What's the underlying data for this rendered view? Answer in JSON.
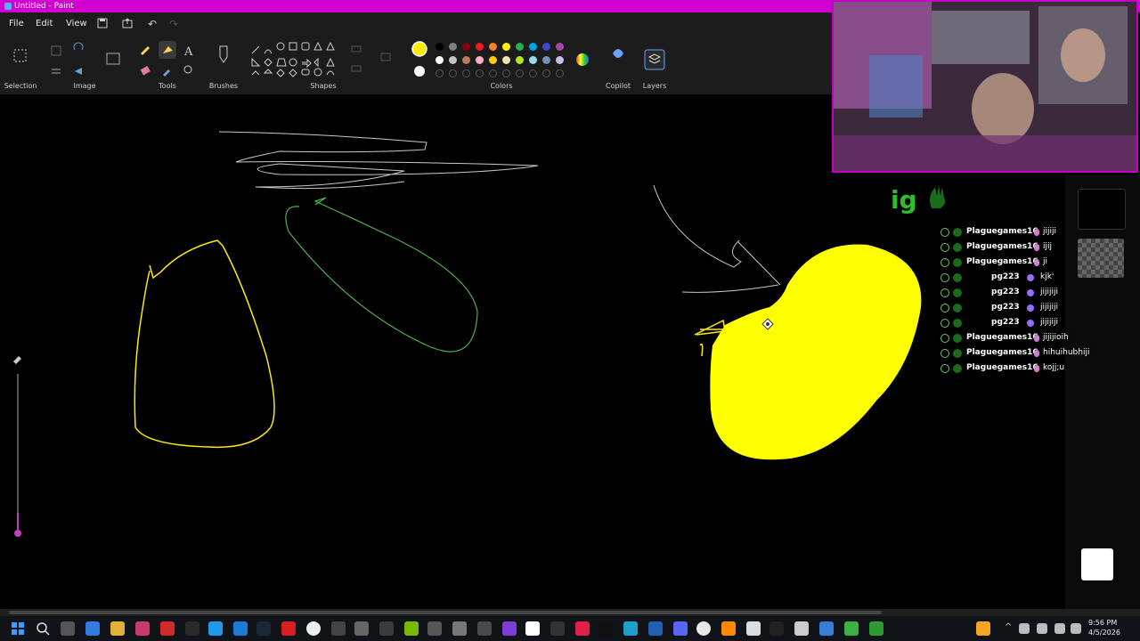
{
  "window": {
    "title": "Untitled - Paint"
  },
  "menu": {
    "file": "File",
    "edit": "Edit",
    "view": "View"
  },
  "ribbon": {
    "groups": {
      "selection": "Selection",
      "image": "Image",
      "tools": "Tools",
      "brushes": "Brushes",
      "shapes": "Shapes",
      "colors": "Colors",
      "copilot": "Copilot",
      "layers": "Layers"
    },
    "active_color": "#ffeb00",
    "palette_row1": [
      "#000000",
      "#7f7f7f",
      "#880015",
      "#ed1c24",
      "#ff7f27",
      "#fff200",
      "#22b14c",
      "#00a2e8",
      "#3f48cc",
      "#a349a4"
    ],
    "palette_row2": [
      "#ffffff",
      "#c3c3c3",
      "#b97a57",
      "#ffaec9",
      "#ffc90e",
      "#efe4b0",
      "#b5e61d",
      "#99d9ea",
      "#7092be",
      "#c8bfe7"
    ]
  },
  "overlay": {
    "ticker": "ig"
  },
  "chat": [
    {
      "user": "Plaguegames16",
      "msg": "jijiji",
      "badge": false
    },
    {
      "user": "Plaguegames16",
      "msg": "ijij",
      "badge": false
    },
    {
      "user": "Plaguegames16",
      "msg": "ji",
      "badge": false
    },
    {
      "user": "pg223",
      "msg": "kjk'",
      "badge": true
    },
    {
      "user": "pg223",
      "msg": "jijijiji",
      "badge": true
    },
    {
      "user": "pg223",
      "msg": "jijijiji",
      "badge": true
    },
    {
      "user": "pg223",
      "msg": "jijijiji",
      "badge": true
    },
    {
      "user": "Plaguegames16",
      "msg": "jijijioih",
      "badge": false
    },
    {
      "user": "Plaguegames16",
      "msg": "hihuihubhiji",
      "badge": false
    },
    {
      "user": "Plaguegames16",
      "msg": "kojj;u",
      "badge": false
    }
  ],
  "clock": {
    "time": "9:56 PM",
    "date": "4/5/2026"
  },
  "colors": {
    "accent": "#d100d1",
    "ribbon": "#1c1c1c",
    "canvas": "#000000"
  }
}
